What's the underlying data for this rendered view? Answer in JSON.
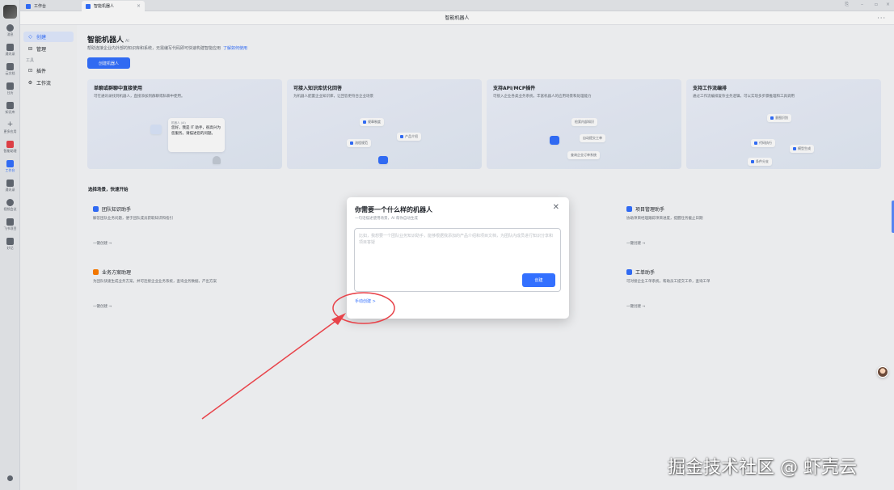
{
  "tabs": [
    {
      "label": "工作台"
    },
    {
      "label": "智能机器人"
    }
  ],
  "window_title": "智能机器人",
  "rail": {
    "items": [
      {
        "label": "消息"
      },
      {
        "label": "通讯录"
      },
      {
        "label": "云文档"
      },
      {
        "label": "日历"
      },
      {
        "label": "知识库"
      },
      {
        "label": "更多应用"
      },
      {
        "label": "智能助理"
      },
      {
        "label": "工作台"
      },
      {
        "label": "通讯录"
      },
      {
        "label": "视频会议"
      },
      {
        "label": "飞书项目"
      },
      {
        "label": "妙记"
      }
    ]
  },
  "sidebar": {
    "create": "创建",
    "manage": "管理",
    "group_tools": "工具",
    "plugins": "插件",
    "workflow": "工作流"
  },
  "header": {
    "title": "智能机器人",
    "version": "AI",
    "desc": "帮助连接企业内外部的知识库和系统，无需编写代码即可快速构建智能应用",
    "learn_more": "了解如何使用",
    "create_button": "创建机器人"
  },
  "features": [
    {
      "title": "单聊或群聊中直接使用",
      "desc": "可在通讯录找到机器人，直接添加到群聊或私聊中使用。",
      "bubble_name": "机器人 (AI)",
      "bubble_text": "您好，我是 IT 助手，很高兴为您服务。请描述您的问题。"
    },
    {
      "title": "可接入知识库优化回答",
      "desc": "为机器人配置企业知识库，让回答更符合企业场景",
      "chips": [
        "规章制度",
        "产品介绍",
        "流程规范"
      ]
    },
    {
      "title": "支持API/MCP插件",
      "desc": "可接入企业各类业务系统，丰富机器人的应用场景和处理能力",
      "chips": [
        "检索内部知识",
        "自动提交工单",
        "查询企业订单系统"
      ]
    },
    {
      "title": "支持工作流编排",
      "desc": "通过工作流编排复杂业务逻辑，可以实现多步骤推理和工具调用",
      "chips": [
        "意图识别",
        "代码执行",
        "模型生成",
        "条件分支"
      ]
    }
  ],
  "scenarios_title": "选择场景，快速开始",
  "scenarios": [
    {
      "title": "团队知识助手",
      "desc": "解答团队业务问题，便于团队成员获取知识和指引",
      "link": "一键创建 →",
      "color": "#3370ff"
    },
    {
      "title": "项目管理助手",
      "desc": "协助项目经理跟踪项目进度，提醒任务截止日期",
      "link": "一键创建 →",
      "color": "#3370ff"
    },
    {
      "title": "业务方案助理",
      "desc": "为团队快速生成业务方案，并可连接企业业务系统，查询业务数据，产出方案",
      "link": "一键创建 →",
      "color": "#ff7d00"
    },
    {
      "title": "工单助手",
      "desc": "可对接企业工单系统，帮助员工提交工单，查询工单",
      "link": "一键创建 →",
      "color": "#3370ff"
    }
  ],
  "modal": {
    "title": "你需要一个什么样的机器人",
    "subtitle": "一句话描述使用场景，AI 帮你自动生成",
    "placeholder": "比如，我想要一个团队业务知识助手，能够根据我添加的产品介绍和项目文档，为团队内成员进行知识分享和项目答疑",
    "create_button": "创建",
    "manual_create": "手动创建 >",
    "close": "✕"
  },
  "watermark": "掘金技术社区 @ 虾壳云",
  "colors": {
    "accent": "#3370ff",
    "annotation": "#e8434a"
  }
}
